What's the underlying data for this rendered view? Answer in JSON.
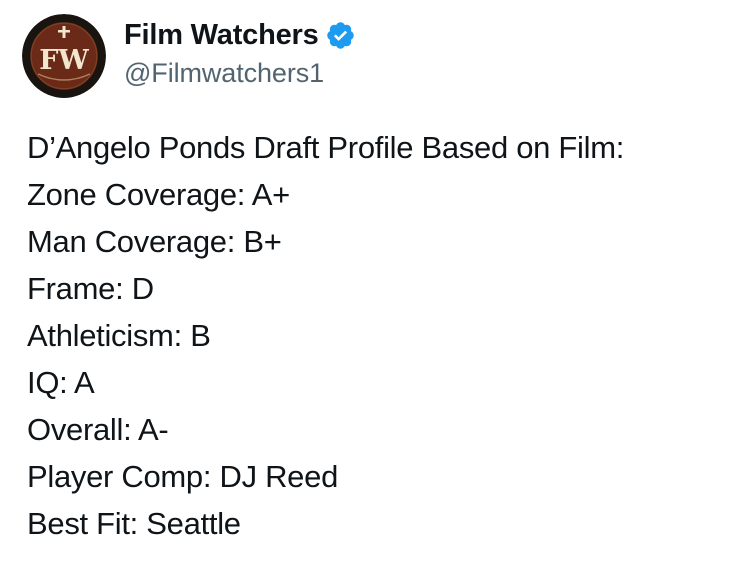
{
  "author": {
    "display_name": "Film Watchers",
    "handle": "@Filmwatchers1",
    "avatar_text": "FW",
    "verified": true,
    "verified_color": "#1d9bf0"
  },
  "tweet": {
    "lines": [
      "D’Angelo Ponds Draft Profile Based on Film:",
      "Zone Coverage: A+",
      "Man Coverage: B+",
      "Frame: D",
      "Athleticism: B",
      "IQ: A",
      "Overall: A-",
      "Player Comp: DJ Reed",
      "Best Fit: Seattle"
    ]
  },
  "colors": {
    "text_primary": "#0f1419",
    "text_secondary": "#536471",
    "avatar_ring": "#1a1410",
    "avatar_fill": "#6b2a18",
    "avatar_letters": "#f2e6cf"
  },
  "icons": {
    "verified": "verified-badge-icon",
    "avatar": "film-watchers-logo"
  }
}
